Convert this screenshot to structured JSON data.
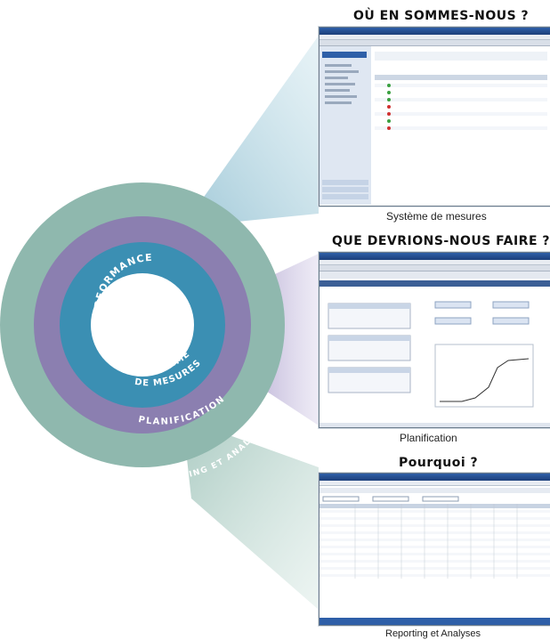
{
  "rings": [
    {
      "label": "PERFORMANCE",
      "color": "#ffffff"
    },
    {
      "label": "SYSTÈME",
      "color": "#3b8fb3"
    },
    {
      "label": "DE MESURES",
      "color": "#3b8fb3"
    },
    {
      "label": "PLANIFICATION",
      "color": "#8b7fb0"
    },
    {
      "label": "REPORTING ET ANALYSE",
      "color": "#8fb8ae"
    }
  ],
  "panels": [
    {
      "heading": "OÙ EN SOMMES-NOUS ?",
      "caption": "Système de mesures"
    },
    {
      "heading": "QUE DEVRIONS-NOUS FAIRE ?",
      "caption": "Planification"
    },
    {
      "heading": "Pourquoi ?",
      "caption": "Reporting et Analyses"
    }
  ],
  "colors": {
    "outer_ring": "#8fb8ae",
    "middle_ring": "#8b7fb0",
    "inner_ring": "#3b8fb3",
    "center": "#ffffff",
    "beam_top": "#b7d5df",
    "beam_mid": "#c3bbd6",
    "beam_low": "#bcd4cd"
  }
}
